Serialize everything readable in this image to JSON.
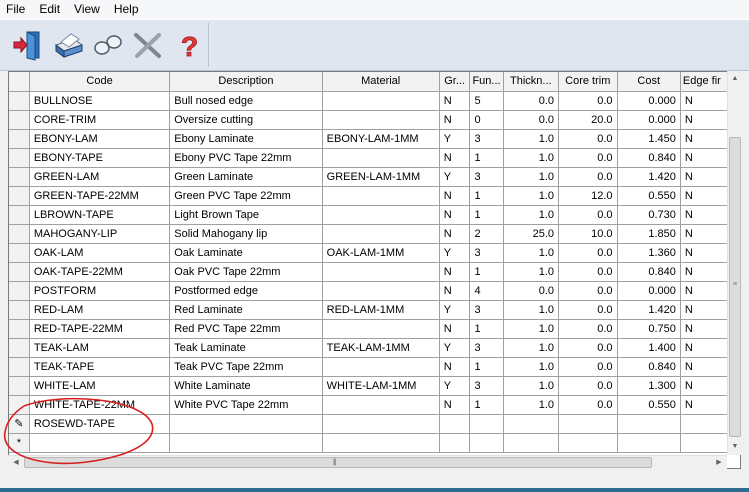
{
  "menu": [
    "File",
    "Edit",
    "View",
    "Help"
  ],
  "toolbar": {
    "buttons": [
      {
        "name": "exit-icon",
        "label": "Exit"
      },
      {
        "name": "print-icon",
        "label": "Print"
      },
      {
        "name": "find-icon",
        "label": "Find"
      },
      {
        "name": "tools-icon",
        "label": "Tools"
      },
      {
        "name": "help-icon",
        "label": "?"
      }
    ]
  },
  "grid": {
    "columns": [
      "Code",
      "Description",
      "Material",
      "Gr...",
      "Fun...",
      "Thickn...",
      "Core trim",
      "Cost",
      "Edge fir"
    ],
    "rows": [
      [
        "BULLNOSE",
        "Bull nosed edge",
        "",
        "N",
        "5",
        "0.0",
        "0.0",
        "0.000",
        "N"
      ],
      [
        "CORE-TRIM",
        "Oversize cutting",
        "",
        "N",
        "0",
        "0.0",
        "20.0",
        "0.000",
        "N"
      ],
      [
        "EBONY-LAM",
        "Ebony Laminate",
        "EBONY-LAM-1MM",
        "Y",
        "3",
        "1.0",
        "0.0",
        "1.450",
        "N"
      ],
      [
        "EBONY-TAPE",
        "Ebony PVC Tape 22mm",
        "",
        "N",
        "1",
        "1.0",
        "0.0",
        "0.840",
        "N"
      ],
      [
        "GREEN-LAM",
        "Green Laminate",
        "GREEN-LAM-1MM",
        "Y",
        "3",
        "1.0",
        "0.0",
        "1.420",
        "N"
      ],
      [
        "GREEN-TAPE-22MM",
        "Green PVC Tape 22mm",
        "",
        "N",
        "1",
        "1.0",
        "12.0",
        "0.550",
        "N"
      ],
      [
        "LBROWN-TAPE",
        "Light Brown Tape",
        "",
        "N",
        "1",
        "1.0",
        "0.0",
        "0.730",
        "N"
      ],
      [
        "MAHOGANY-LIP",
        "Solid Mahogany lip",
        "",
        "N",
        "2",
        "25.0",
        "10.0",
        "1.850",
        "N"
      ],
      [
        "OAK-LAM",
        "Oak Laminate",
        "OAK-LAM-1MM",
        "Y",
        "3",
        "1.0",
        "0.0",
        "1.360",
        "N"
      ],
      [
        "OAK-TAPE-22MM",
        "Oak PVC Tape 22mm",
        "",
        "N",
        "1",
        "1.0",
        "0.0",
        "0.840",
        "N"
      ],
      [
        "POSTFORM",
        "Postformed edge",
        "",
        "N",
        "4",
        "0.0",
        "0.0",
        "0.000",
        "N"
      ],
      [
        "RED-LAM",
        "Red Laminate",
        "RED-LAM-1MM",
        "Y",
        "3",
        "1.0",
        "0.0",
        "1.420",
        "N"
      ],
      [
        "RED-TAPE-22MM",
        "Red PVC Tape 22mm",
        "",
        "N",
        "1",
        "1.0",
        "0.0",
        "0.750",
        "N"
      ],
      [
        "TEAK-LAM",
        "Teak Laminate",
        "TEAK-LAM-1MM",
        "Y",
        "3",
        "1.0",
        "0.0",
        "1.400",
        "N"
      ],
      [
        "TEAK-TAPE",
        "Teak PVC Tape 22mm",
        "",
        "N",
        "1",
        "1.0",
        "0.0",
        "0.840",
        "N"
      ],
      [
        "WHITE-LAM",
        "White Laminate",
        "WHITE-LAM-1MM",
        "Y",
        "3",
        "1.0",
        "0.0",
        "1.300",
        "N"
      ],
      [
        "WHITE-TAPE-22MM",
        "White PVC Tape 22mm",
        "",
        "N",
        "1",
        "1.0",
        "0.0",
        "0.550",
        "N"
      ]
    ],
    "editing_row": {
      "marker": "✎",
      "code": "ROSEWD-TAPE"
    },
    "new_row": {
      "marker": "*"
    }
  },
  "colors": {
    "annotation": "#d81e1e",
    "accent": "#2e6b8f"
  }
}
